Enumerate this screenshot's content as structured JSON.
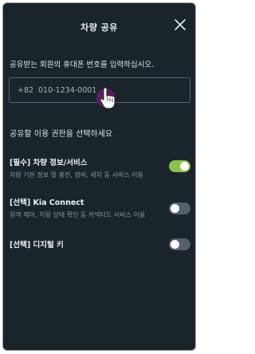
{
  "header": {
    "title": "차량 공유"
  },
  "phone": {
    "prompt": "공유받는 회원의 휴대폰 번호를 입력하십시오.",
    "country_code": "+82",
    "placeholder": "010-1234-0001"
  },
  "permissions": {
    "heading": "공유할 이용 권한을 선택하세요",
    "items": [
      {
        "title": "[필수] 차량 정보/서비스",
        "description": "차량 기본 정보 및 충전, 정비, 세차 등 서비스 이용",
        "enabled": true
      },
      {
        "title": "[선택] Kia Connect",
        "description": "원격 제어, 차량 상태 확인 등 커넥티드 서비스 이용",
        "enabled": false
      },
      {
        "title": "[선택] 디지털 키",
        "description": "",
        "enabled": false
      }
    ]
  },
  "colors": {
    "background": "#1a242b",
    "toggle_on": "#8ac24a",
    "toggle_off": "#566068",
    "touch_indicator": "#5a1f63"
  },
  "icons": [
    "close-icon",
    "pointing-hand-icon"
  ]
}
